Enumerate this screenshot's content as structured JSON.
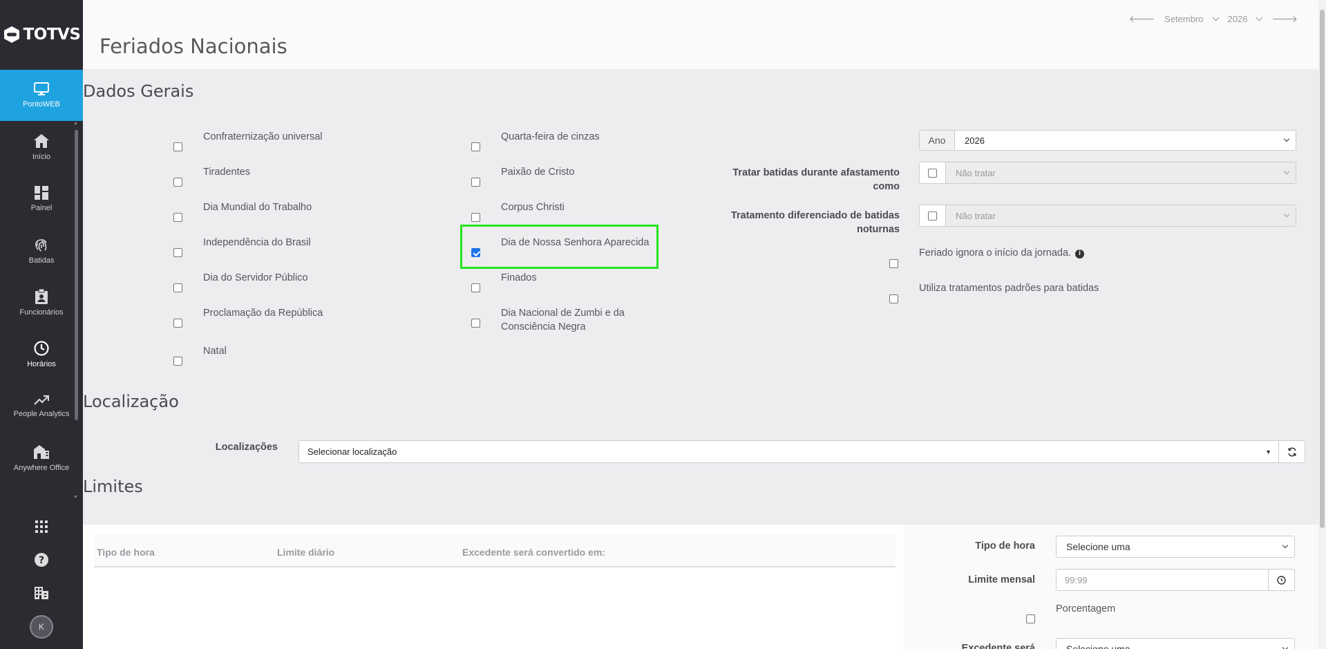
{
  "brand": {
    "logo_text": "TOTVS",
    "accent": "#1fa2e0",
    "highlight": "#22e41c"
  },
  "sidebar": {
    "app_label": "PontoWEB",
    "items": [
      {
        "label": "Início",
        "icon": "home-icon"
      },
      {
        "label": "Painel",
        "icon": "dashboard-icon"
      },
      {
        "label": "Batidas",
        "icon": "fingerprint-icon"
      },
      {
        "label": "Funcionários",
        "icon": "badge-icon"
      },
      {
        "label": "Horários",
        "icon": "clock-icon"
      },
      {
        "label": "People Analytics",
        "icon": "trend-icon"
      },
      {
        "label": "Anywhere Office",
        "icon": "house-office-icon"
      }
    ],
    "avatar_initial": "K"
  },
  "header": {
    "title": "Feriados Nacionais",
    "month": "Setembro",
    "year": "2026"
  },
  "dados_gerais": {
    "title": "Dados Gerais",
    "holidays_col1": [
      {
        "label": "Confraternização universal",
        "checked": false
      },
      {
        "label": "Tiradentes",
        "checked": false
      },
      {
        "label": "Dia Mundial do Trabalho",
        "checked": false
      },
      {
        "label": "Independência do Brasil",
        "checked": false
      },
      {
        "label": "Dia do Servidor Público",
        "checked": false
      },
      {
        "label": "Proclamação da República",
        "checked": false
      },
      {
        "label": "Natal",
        "checked": false
      }
    ],
    "holidays_col2": [
      {
        "label": "Quarta-feira de cinzas",
        "checked": false
      },
      {
        "label": "Paixão de Cristo",
        "checked": false
      },
      {
        "label": "Corpus Christi",
        "checked": false
      },
      {
        "label": "Dia de Nossa Senhora Aparecida",
        "checked": true
      },
      {
        "label": "Finados",
        "checked": false
      },
      {
        "label": "Dia Nacional de Zumbi e da\nConsciência Negra",
        "checked": false
      }
    ],
    "ano_label": "Ano",
    "ano_value": "2026",
    "tratar_afastamento_label": "Tratar batidas durante afastamento como",
    "tratar_afastamento_value": "Não tratar",
    "tratamento_noturnas_label": "Tratamento diferenciado de batidas noturnas",
    "tratamento_noturnas_value": "Não tratar",
    "ignora_jornada_label": "Feriado ignora o início da jornada.",
    "padroes_label": "Utiliza tratamentos padrões para batidas"
  },
  "localizacao": {
    "title": "Localização",
    "label": "Localizações",
    "placeholder": "Selecionar localização"
  },
  "limites": {
    "title": "Limites",
    "columns": [
      "Tipo de hora",
      "Limite diário",
      "Excedente será convertido em:"
    ],
    "tipo_hora_label": "Tipo de hora",
    "tipo_hora_value": "Selecione uma",
    "limite_mensal_label": "Limite mensal",
    "limite_mensal_placeholder": "99:99",
    "porcentagem_label": "Porcentagem",
    "excedente_label": "Excedente será",
    "excedente_value": "Selecione uma"
  }
}
